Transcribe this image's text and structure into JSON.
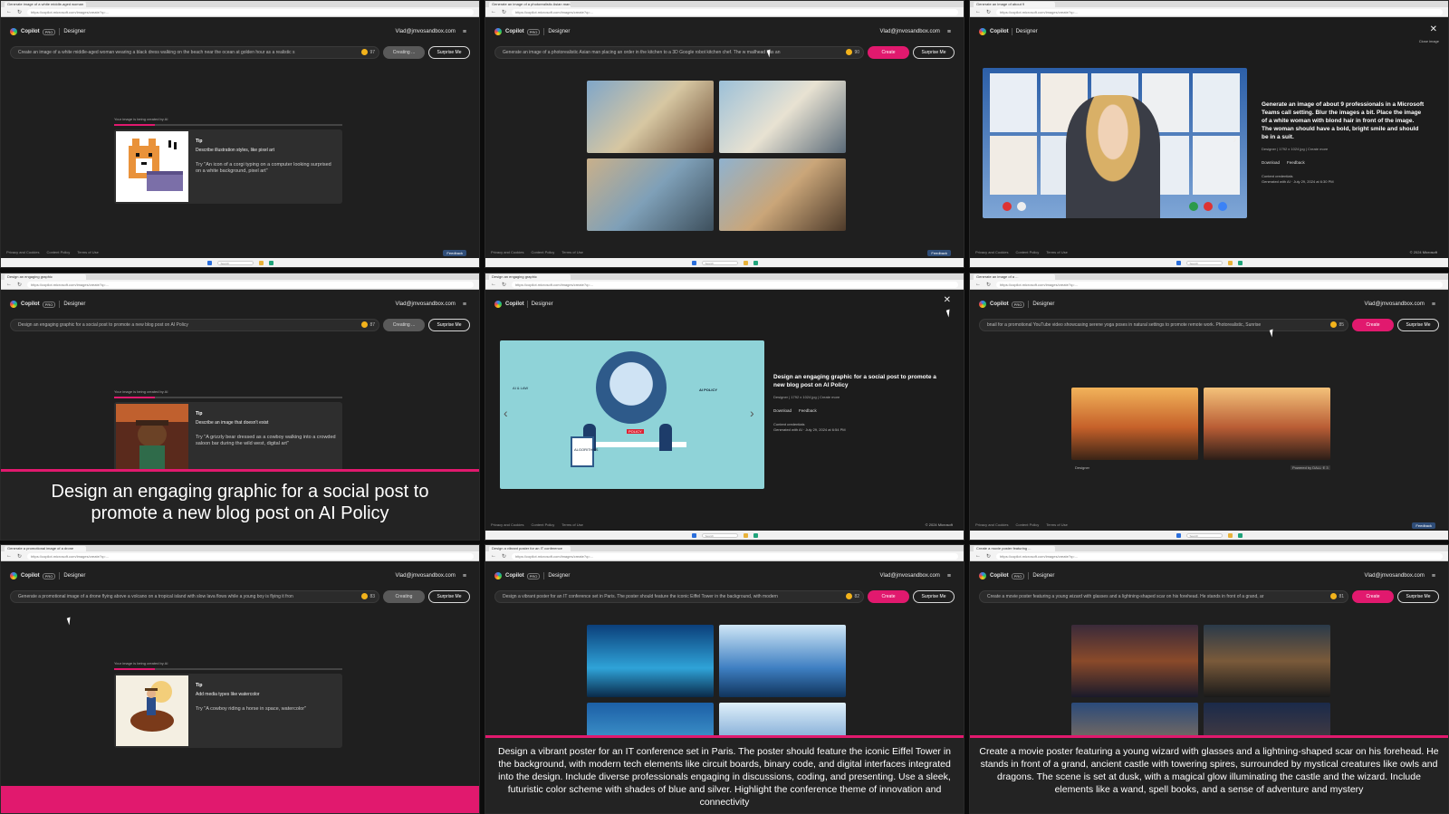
{
  "shared": {
    "brand": "Copilot",
    "pro_badge": "PRO",
    "designer": "Designer",
    "email": "Vlad@jmvosandbox.com",
    "menu_icon": "hamburger-menu-icon",
    "create_label": "Create",
    "creating_label": "Creating ...",
    "surprise_label": "Surprise Me",
    "footer_links": [
      "Privacy and Cookies",
      "Content Policy",
      "Terms of Use"
    ],
    "feedback": "Feedback",
    "loading_text": "Your image is being created by AI",
    "tip_label": "Tip",
    "search_label": "Search",
    "url": "https://copilot.microsoft.com/images/create?q=...",
    "accent": "#e1196e"
  },
  "panels": [
    {
      "tab": "Generate image of a white middle-aged woman",
      "prompt": "Create an image of a white middle-aged woman wearing a black dress walking on the beach near the ocean at golden hour as a realistic s",
      "coins": "97",
      "button": "Creating ...",
      "tip_sub": "Describe illustration styles, like pixel art",
      "tip_try": "Try \"An icon of a corgi typing on a computer looking surprised on a white background, pixel art\""
    },
    {
      "tab": "Generate an image of a photorealistic Asian man",
      "prompt": "Generate an image of a photorealistic Asian man placing an order in the kitchen to a 3D Google robot kitchen chef. The w   mailhead has an",
      "coins": "90",
      "button": "Create"
    },
    {
      "tab": "Generate an image of about 9",
      "detail_title": "Generate an image of about 9 professionals in a Microsoft Teams call setting. Blur the images a bit. Place the image of a white woman with blond hair in front of the image. The woman should have a bold, bright smile and should be in a suit.",
      "meta": "Designer | 1792 x 1024 jpg | Create more",
      "download": "Download",
      "feedback": "Feedback",
      "credentials": "Content credentials",
      "generated": "Generated with AI · July 29, 2024 at 6:30 PM",
      "copyright": "© 2024 Microsoft",
      "close_tip": "Close image"
    },
    {
      "tab": "Design an engaging graphic",
      "prompt": "Design an engaging graphic for a social post to promote a new blog post on AI Policy",
      "coins": "87",
      "button": "Creating ...",
      "tip_sub": "Describe an image that doesn't exist",
      "tip_try": "Try \"A grizzly bear dressed as a cowboy walking into a crowded saloon bar during the wild west, digital art\"",
      "caption": "Design an engaging graphic for a social post to promote a new blog post on AI Policy"
    },
    {
      "tab": "Design an engaging graphic",
      "detail_title": "Design an engaging graphic for a social post to promote a new blog post on AI Policy",
      "meta": "Designer | 1792 x 1024 jpg | Create more",
      "download": "Download",
      "feedback": "Feedback",
      "credentials": "Content credentials",
      "generated": "Generated with AI · July 29, 2024 at 6:54 PM",
      "copyright": "© 2024 Microsoft",
      "poster_words": [
        "AI POLICY",
        "POLICY",
        "AI & LAW",
        "ALGORITHMS"
      ]
    },
    {
      "tab": "Generate an image of a ...",
      "prompt": "bnail for a promotional YouTube video showcasing serene yoga poses in natural settings to promote remote work. Photorealistic, Sunrise",
      "coins": "85",
      "button": "Create",
      "designer_tag": "Designer",
      "powered": "Powered by DALL·E 3"
    },
    {
      "tab": "Generate a promotional image of a drone",
      "prompt": "Generate a promotional image of a drone flying above a volcano on a tropical island with slow lava flows while a young boy is flying it fron",
      "coins": "83",
      "button": "Creating",
      "tip_sub": "Add media types like watercolor",
      "tip_try": "Try \"A cowboy riding a horse in space, watercolor\""
    },
    {
      "tab": "Design a vibrant poster for an IT conference",
      "prompt": "Design a vibrant poster for an IT conference set in Paris. The poster should feature the iconic Eiffel Tower in the background, with modern",
      "coins": "82",
      "button": "Create",
      "caption": "Design a vibrant poster for an IT conference set in Paris. The poster should feature the iconic Eiffel Tower in the background, with modern tech elements like circuit boards, binary code, and digital interfaces integrated into the design. Include diverse professionals engaging in discussions, coding, and presenting. Use a sleek, futuristic color scheme with shades of blue and silver. Highlight the conference theme of innovation and connectivity"
    },
    {
      "tab": "Create a movie poster featuring ...",
      "prompt": "Create a movie poster featuring a young wizard with glasses and a lightning-shaped scar on his forehead. He stands in front of a grand, ar",
      "coins": "81",
      "button": "Create",
      "caption": "Create a movie poster featuring a young wizard with glasses and a lightning-shaped scar on his forehead. He stands in front of a grand, ancient castle with towering spires, surrounded by mystical creatures like owls and dragons. The scene is set at dusk, with a magical glow illuminating the castle and the wizard. Include elements like a wand, spell books, and a sense of adventure and mystery"
    }
  ]
}
